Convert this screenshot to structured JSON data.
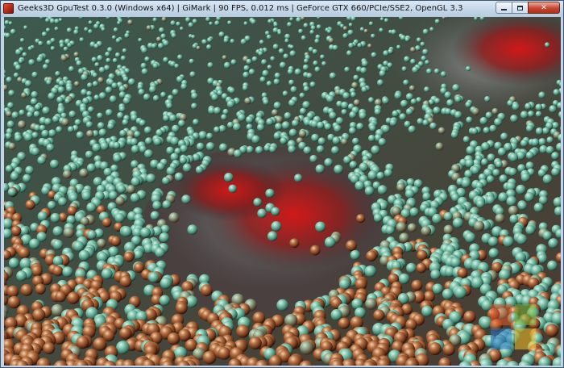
{
  "window": {
    "title": "Geeks3D GpuTest 0.3.0 (Windows x64) | GiMark | 90 FPS, 0.012 ms | GeForce GTX 660/PCIe/SSE2, OpenGL 3.3",
    "icon": "app-icon",
    "controls": [
      "minimize-icon",
      "maximize-icon",
      "close-icon"
    ],
    "close_glyph": "✕"
  },
  "scene": {
    "description_icon": "gimark-particles",
    "colors": {
      "sphere_teal": "#7fc6b0",
      "sphere_copper": "#a8643c",
      "cloud_red": "#c21414",
      "cloud_grey": "#8a8a8a"
    }
  }
}
